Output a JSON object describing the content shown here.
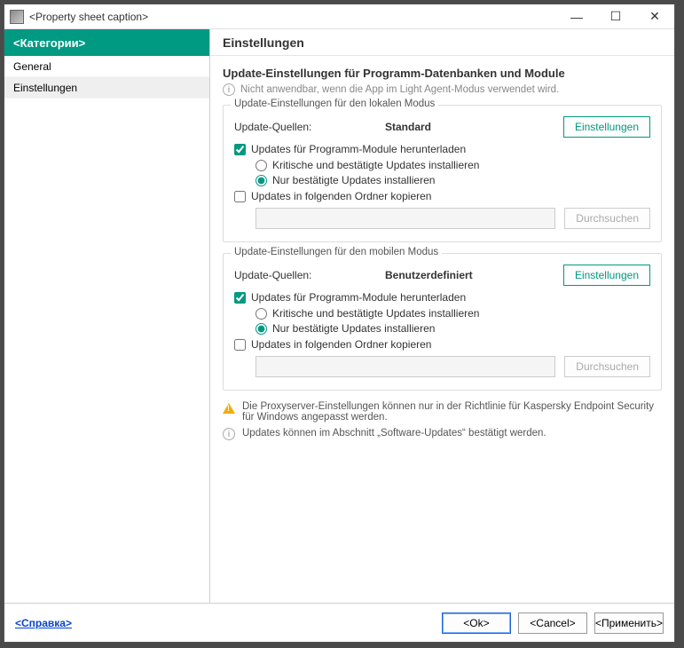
{
  "titlebar": {
    "caption": "<Property sheet caption>"
  },
  "sidebar": {
    "header": "<Категории>",
    "items": [
      {
        "label": "General",
        "selected": false
      },
      {
        "label": "Einstellungen",
        "selected": true
      }
    ]
  },
  "main": {
    "header": "Einstellungen",
    "title": "Update-Einstellungen für Programm-Datenbanken und Module",
    "light_agent_note": "Nicht anwendbar, wenn die App im Light Agent-Modus verwendet wird.",
    "local": {
      "legend": "Update-Einstellungen für den lokalen Modus",
      "sources_label": "Update-Quellen:",
      "sources_value": "Standard",
      "settings_btn": "Einstellungen",
      "download_modules_label": "Updates für Programm-Module herunterladen",
      "download_modules_checked": true,
      "radio_critical": "Kritische und bestätigte Updates installieren",
      "radio_confirmed": "Nur bestätigte Updates installieren",
      "radio_selected": "confirmed",
      "copy_folder_label": "Updates in folgenden Ordner kopieren",
      "copy_folder_checked": false,
      "browse_btn": "Durchsuchen"
    },
    "mobile": {
      "legend": "Update-Einstellungen für den mobilen Modus",
      "sources_label": "Update-Quellen:",
      "sources_value": "Benutzerdefiniert",
      "settings_btn": "Einstellungen",
      "download_modules_label": "Updates für Programm-Module herunterladen",
      "download_modules_checked": true,
      "radio_critical": "Kritische und bestätigte Updates installieren",
      "radio_confirmed": "Nur bestätigte Updates installieren",
      "radio_selected": "confirmed",
      "copy_folder_label": "Updates in folgenden Ordner kopieren",
      "copy_folder_checked": false,
      "browse_btn": "Durchsuchen"
    },
    "proxy_warning": "Die Proxyserver-Einstellungen können nur in der Richtlinie für Kaspersky Endpoint Security für Windows angepasst werden.",
    "confirm_info": "Updates können im Abschnitt „Software-Updates“ bestätigt werden."
  },
  "footer": {
    "help": "<Справка>",
    "ok": "<Ok>",
    "cancel": "<Cancel>",
    "apply": "<Применить>"
  }
}
